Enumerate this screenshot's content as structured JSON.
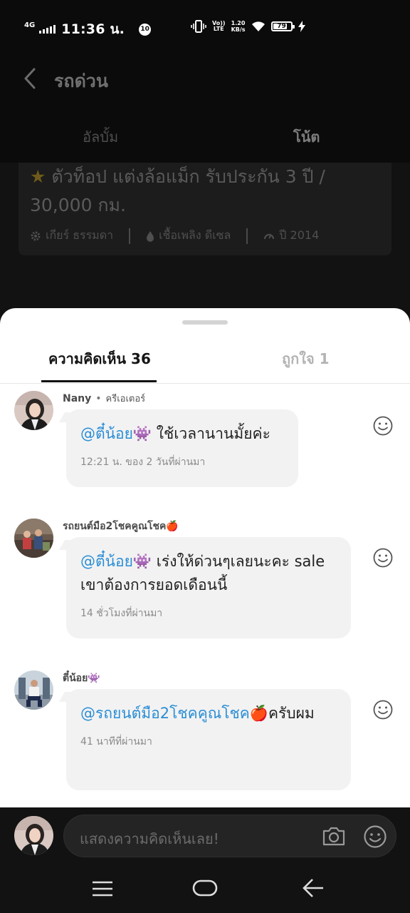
{
  "status_bar": {
    "network": "4G",
    "time": "11:36 น.",
    "notification_count": "10",
    "volte_top": "Vo))",
    "volte_bottom": "LTE",
    "speed_value": "1.20",
    "speed_unit": "KB/s",
    "battery_level": "79",
    "battery_fraction": 0.79
  },
  "header": {
    "title": "รถด่วน",
    "tabs": [
      "อัลบั้ม",
      "โน้ต"
    ]
  },
  "background_card": {
    "star": "★",
    "title": "ตัวท็อป แต่งล้อแม็ก รับประกัน 3 ปี / 30,000 กม.",
    "specs": [
      "เกียร์ ธรรมดา",
      "เชื้อเพลิง ดีเซล",
      "ปี 2014"
    ]
  },
  "sheet": {
    "tabs": {
      "comments": "ความคิดเห็น 36",
      "likes": "ถูกใจ 1"
    }
  },
  "comments": [
    {
      "author": "Nany",
      "dot": "•",
      "role": "ครีเอเตอร์",
      "mention": "@ตี๋น้อย👾",
      "text": " ใช้เวลานานมั้ยค่ะ",
      "time": "12:21 น. ของ 2 วันที่ผ่านมา"
    },
    {
      "author": "รถยนต์มือ2โชคคูณโชค🍎",
      "mention": "@ตี๋น้อย👾",
      "text": " เร่งให้ด่วนๆเลยนะคะ sale เขาต้องการยอดเดือนนี้",
      "time": "14 ชั่วโมงที่ผ่านมา"
    },
    {
      "author": "ตี๋น้อย👾",
      "mention": "@รถยนต์มือ2โชคคูณโชค🍎",
      "text": "ครับผม",
      "time": "41 นาทีที่ผ่านมา"
    }
  ],
  "input": {
    "placeholder": "แสดงความคิดเห็นเลย!"
  },
  "colors": {
    "mention": "#2a8ed6",
    "bubble": "#f2f2f2",
    "background": "#121212"
  }
}
